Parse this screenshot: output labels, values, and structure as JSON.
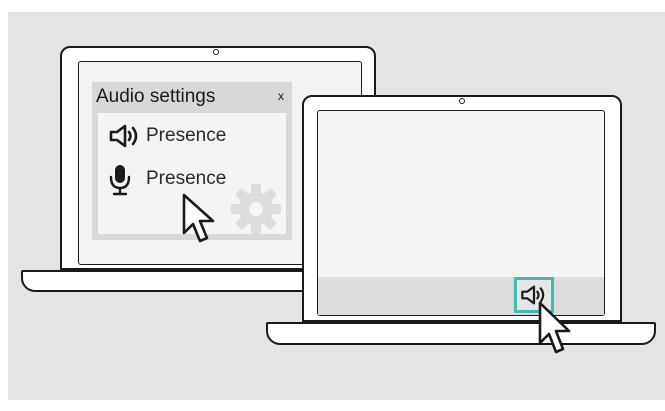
{
  "dialog": {
    "title": "Audio settings",
    "close_label": "x",
    "options": [
      {
        "icon": "speaker-icon",
        "label": "Presence"
      },
      {
        "icon": "microphone-icon",
        "label": "Presence"
      }
    ],
    "settings_icon": "gear-icon"
  },
  "taskbar": {
    "tray_icon": "speaker-icon",
    "highlight_color": "#45b8b5"
  },
  "colors": {
    "background": "#e4e4e4",
    "outline": "#1a1a1a"
  }
}
